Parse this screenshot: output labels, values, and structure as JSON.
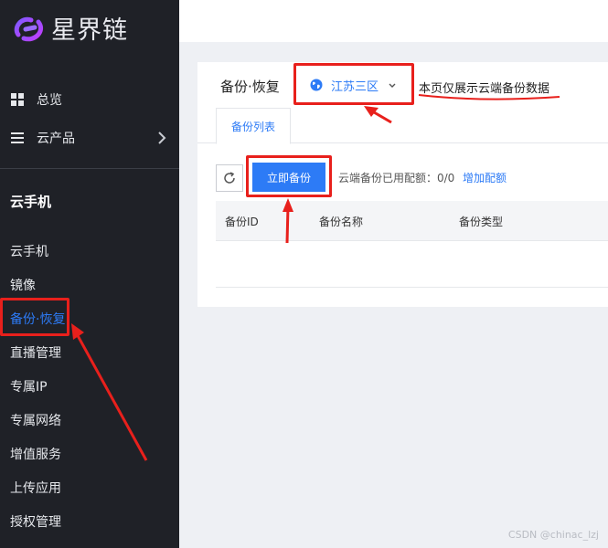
{
  "brand": {
    "name": "星界链"
  },
  "sidebar": {
    "top_items": [
      {
        "label": "总览",
        "icon": "grid-icon"
      },
      {
        "label": "云产品",
        "icon": "menu-icon"
      }
    ],
    "section_title": "云手机",
    "items": [
      {
        "label": "云手机"
      },
      {
        "label": "镜像"
      },
      {
        "label": "备份·恢复",
        "active": true
      },
      {
        "label": "直播管理"
      },
      {
        "label": "专属IP"
      },
      {
        "label": "专属网络"
      },
      {
        "label": "增值服务"
      },
      {
        "label": "上传应用"
      },
      {
        "label": "授权管理"
      }
    ]
  },
  "header": {
    "title": "备份·恢复",
    "region": "江苏三区",
    "note": "本页仅展示云端备份数据"
  },
  "tabs": [
    {
      "label": "备份列表"
    }
  ],
  "toolbar": {
    "backup_label": "立即备份",
    "quota_text": "云端备份已用配额：0/0",
    "add_quota_label": "增加配额"
  },
  "table": {
    "columns": [
      "备份ID",
      "备份名称",
      "备份类型"
    ]
  },
  "watermark": "CSDN @chinac_lzj",
  "colors": {
    "accent": "#2d7bf6",
    "sidebar": "#1f2127",
    "annotation": "#e8201c"
  }
}
